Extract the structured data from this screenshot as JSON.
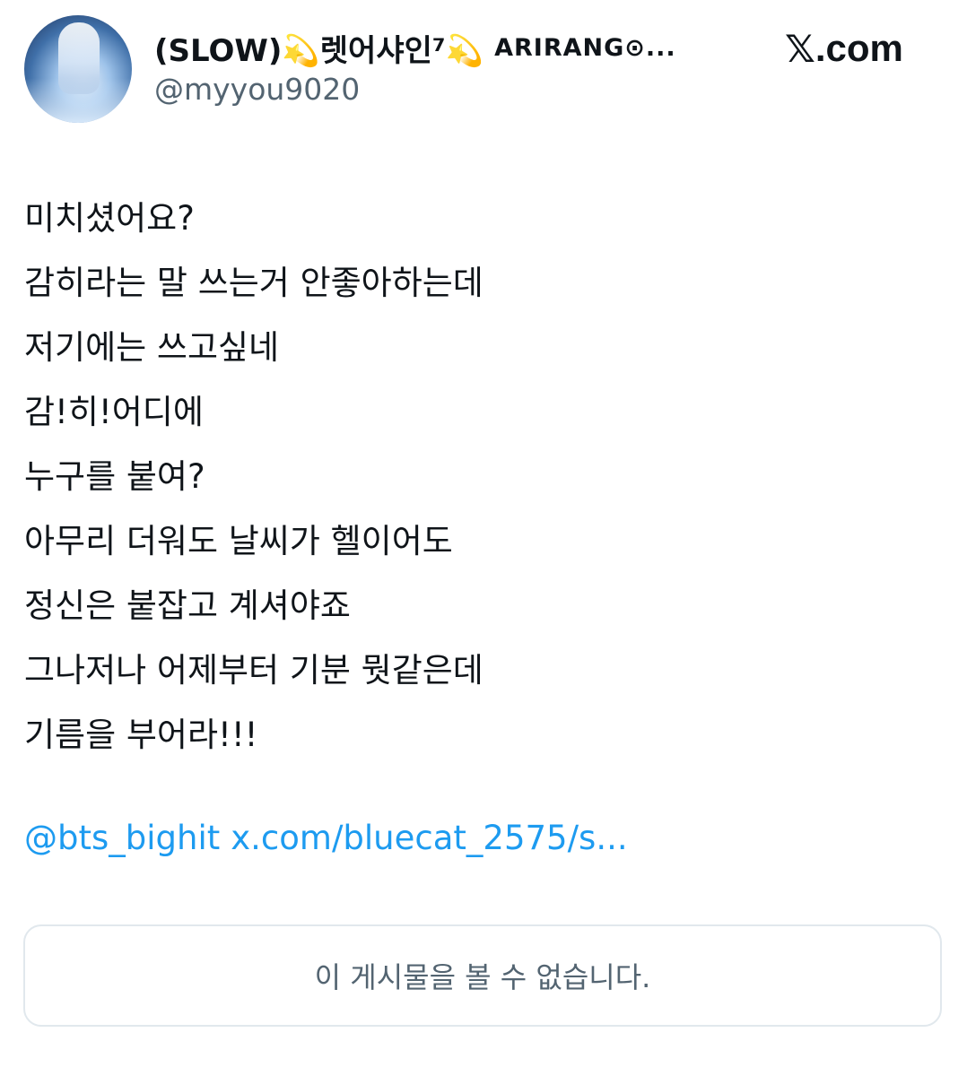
{
  "author": {
    "display_name": "(SLOW)💫렛어샤인⁷💫",
    "display_name_tail": "ARIRANG⊙...",
    "handle": "@myyou9020",
    "avatar": "avatar-photo"
  },
  "brand": {
    "x_glyph": "𝕏",
    "suffix": ".com"
  },
  "tweet": {
    "lines": [
      "미치셨어요?",
      "감히라는 말 쓰는거 안좋아하는데",
      "저기에는 쓰고싶네",
      "감!히!어디에",
      "누구를 붙여?",
      "아무리 더워도 날씨가 헬이어도",
      "정신은 붙잡고 계셔야죠",
      "그나저나 어제부터 기분 뭣같은데",
      "기름을 부어라!!!"
    ],
    "mention": "@bts_bighit",
    "link": "x.com/bluecat_2575/s..."
  },
  "quoted": {
    "unavailable_text": "이 게시물을 볼 수 없습니다."
  },
  "colors": {
    "text": "#0f1419",
    "secondary": "#536471",
    "link": "#1d9bf0",
    "border": "#e1e8ed"
  }
}
